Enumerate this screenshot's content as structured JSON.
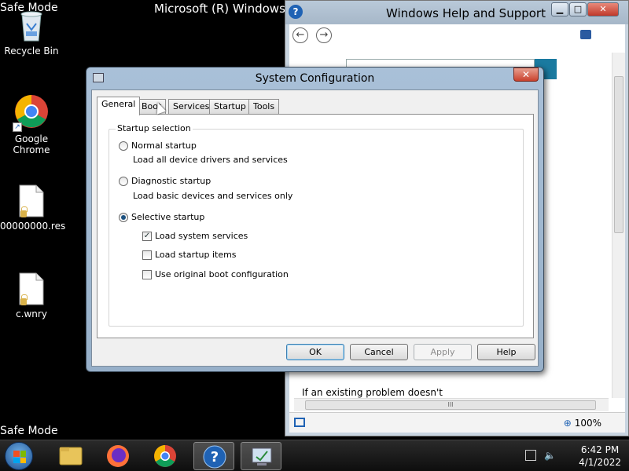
{
  "desktop": {
    "safe_mode_top": "Safe Mode",
    "safe_mode_bottom": "Safe Mode",
    "os_title": "Microsoft (R) Windows (R",
    "icons": [
      {
        "label": "Recycle Bin",
        "icon": "recycle-bin-icon"
      },
      {
        "label": "Google\nChrome",
        "icon": "chrome-icon"
      },
      {
        "label": "00000000.res",
        "icon": "file-icon"
      },
      {
        "label": "c.wnry",
        "icon": "file-icon"
      }
    ]
  },
  "help_window": {
    "title": "Windows Help and Support",
    "text": "If an existing problem doesn't",
    "zoom": "100%",
    "scroll_grip": "III"
  },
  "dialog": {
    "title": "System Configuration",
    "close": "✕",
    "tabs": [
      "General",
      "Boot",
      "Services",
      "Startup",
      "Tools"
    ],
    "group_title": "Startup selection",
    "normal_label": "Normal startup",
    "normal_desc": "Load all device drivers and services",
    "diagnostic_label": "Diagnostic startup",
    "diagnostic_desc": "Load basic devices and services only",
    "selective_label": "Selective startup",
    "load_services": "Load system services",
    "load_startup": "Load startup items",
    "use_boot": "Use original boot configuration",
    "ok": "OK",
    "cancel": "Cancel",
    "apply": "Apply",
    "help": "Help"
  },
  "taskbar": {
    "time": "6:42 PM",
    "date": "4/1/2022"
  },
  "colors": {
    "dialog_frame": "#a9c0d8",
    "close_red": "#c9412d",
    "taskbar": "#0e0e0e"
  }
}
